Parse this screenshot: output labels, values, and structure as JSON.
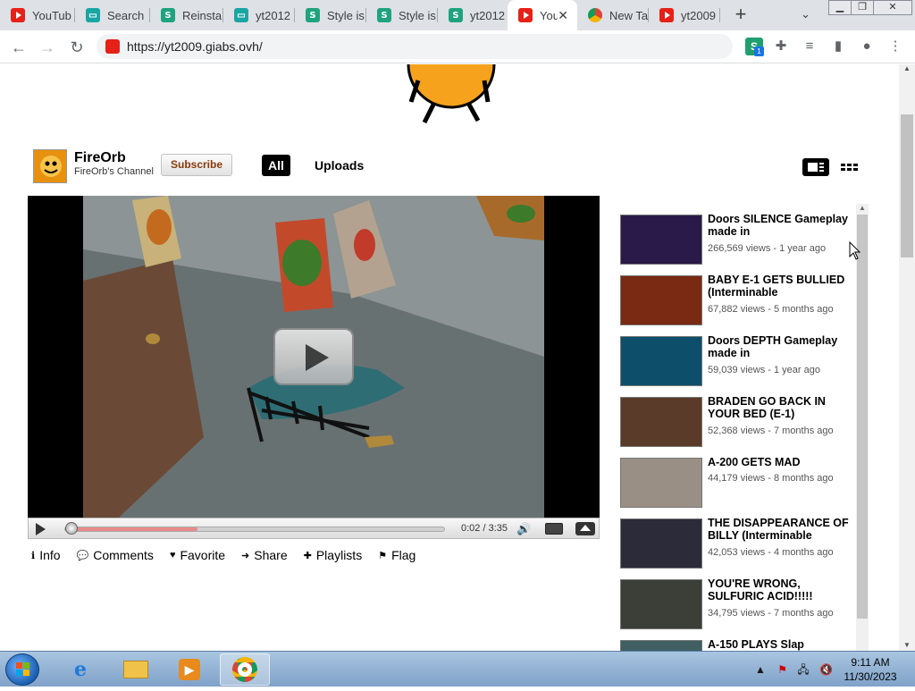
{
  "browser": {
    "tabs": [
      {
        "label": "YouTub",
        "favicon": "youtube-icon"
      },
      {
        "label": "Search",
        "favicon": "monitor-icon"
      },
      {
        "label": "Reinsta",
        "favicon": "monitor-icon"
      },
      {
        "label": "yt2012",
        "favicon": "monitor-icon"
      },
      {
        "label": "Style is",
        "favicon": "stylish-icon"
      },
      {
        "label": "Style is",
        "favicon": "stylish-icon"
      },
      {
        "label": "yt2012",
        "favicon": "stylish-icon"
      },
      {
        "label": "You",
        "favicon": "youtube-icon",
        "active": true
      },
      {
        "label": "New Ta",
        "favicon": "chrome-icon"
      },
      {
        "label": "yt2009",
        "favicon": "youtube-icon"
      }
    ],
    "url": "https://yt2009.giabs.ovh/",
    "extension_badge": "1"
  },
  "channel": {
    "name": "FireOrb",
    "subtitle": "FireOrb's Channel",
    "subscribe_label": "Subscribe",
    "tab_all": "All",
    "tab_uploads": "Uploads"
  },
  "player": {
    "time": "0:02 / 3:35",
    "progress_fraction": 0.01,
    "buffered_fraction": 0.35
  },
  "actions": [
    {
      "label": "Info",
      "icon": "info-icon"
    },
    {
      "label": "Comments",
      "icon": "speech-bubble-icon"
    },
    {
      "label": "Favorite",
      "icon": "heart-icon"
    },
    {
      "label": "Share",
      "icon": "arrow-icon"
    },
    {
      "label": "Playlists",
      "icon": "plus-icon"
    },
    {
      "label": "Flag",
      "icon": "flag-icon"
    }
  ],
  "videos": [
    {
      "title": "Doors SILENCE Gameplay made in",
      "meta": "266,569 views - 1 year ago",
      "thumb_color": "#2a1a4a"
    },
    {
      "title": "BABY E-1 GETS BULLIED (Interminable",
      "meta": "67,882 views - 5 months ago",
      "thumb_color": "#7a2a12"
    },
    {
      "title": "Doors DEPTH Gameplay made in",
      "meta": "59,039 views - 1 year ago",
      "thumb_color": "#0d4f6a"
    },
    {
      "title": "BRADEN GO BACK IN YOUR BED (E-1)",
      "meta": "52,368 views - 7 months ago",
      "thumb_color": "#5a3b2a"
    },
    {
      "title": "A-200 GETS MAD",
      "meta": "44,179 views - 8 months ago",
      "thumb_color": "#9a8f84"
    },
    {
      "title": "THE DISAPPEARANCE OF BILLY (Interminable",
      "meta": "42,053 views - 4 months ago",
      "thumb_color": "#2b2b3a"
    },
    {
      "title": "YOU'RE WRONG, SULFURIC ACID!!!!!",
      "meta": "34,795 views - 7 months ago",
      "thumb_color": "#3c3e38"
    },
    {
      "title": "A-150 PLAYS Slap",
      "meta": "",
      "thumb_color": "#3f5f63"
    }
  ],
  "taskbar": {
    "time": "9:11 AM",
    "date": "11/30/2023"
  }
}
